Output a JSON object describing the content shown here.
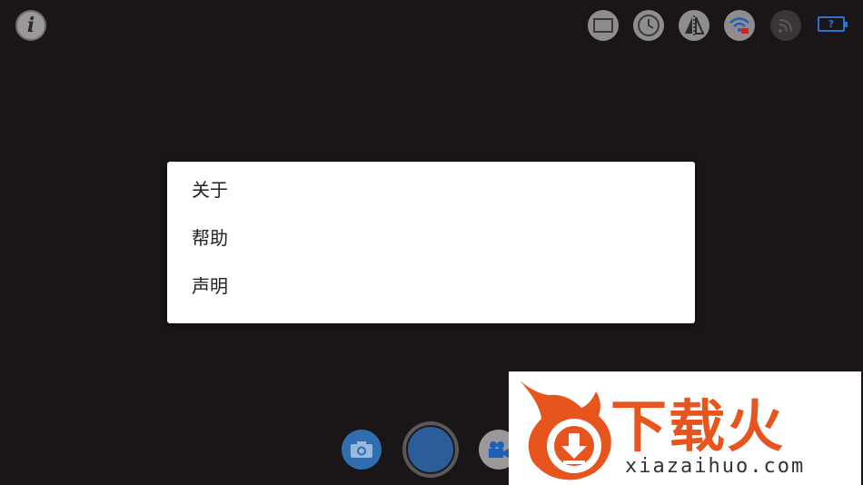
{
  "top_bar": {
    "info_icon_glyph": "i",
    "icons": [
      "screen-ratio-icon",
      "timer-icon",
      "mirror-flip-icon",
      "wifi-status-icon",
      "signal-icon"
    ],
    "battery_glyph": "?"
  },
  "menu": {
    "items": [
      {
        "label": "关于"
      },
      {
        "label": "帮助"
      },
      {
        "label": "声明"
      }
    ]
  },
  "bottom_bar": {
    "buttons": [
      "camera-mode-icon",
      "shutter-button",
      "video-mode-icon"
    ]
  },
  "watermark": {
    "brand": "下载火",
    "url": "xiazaihuo.com",
    "accent_color": "#e8541e"
  },
  "colors": {
    "background": "#1a1617",
    "menu_background": "#ffffff",
    "accent_blue": "#2f6fd0"
  }
}
